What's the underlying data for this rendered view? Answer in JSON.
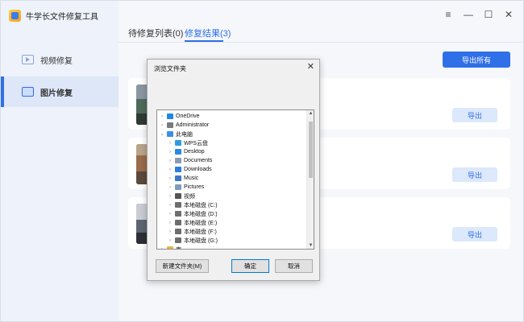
{
  "app": {
    "name": "牛学长文件修复工具",
    "accent": "#2f6fe8"
  },
  "sidebar": {
    "items": [
      {
        "label": "视频修复",
        "icon": "video-icon",
        "active": false
      },
      {
        "label": "图片修复",
        "icon": "image-icon",
        "active": true
      }
    ]
  },
  "tabs": [
    {
      "label": "待修复列表(0)",
      "active": false
    },
    {
      "label": "修复结果(3)",
      "active": true
    }
  ],
  "window_controls": {
    "menu": "≡",
    "minimize": "—",
    "maximize": "☐",
    "close": "✕"
  },
  "toolbar": {
    "export_all_label": "导出所有"
  },
  "results": [
    {
      "export_label": "导出"
    },
    {
      "export_label": "导出"
    },
    {
      "export_label": "导出"
    }
  ],
  "dialog": {
    "title": "浏览文件夹",
    "close": "✕",
    "tree": [
      {
        "label": "OneDrive",
        "icon": "cloud-icon",
        "color": "#1e88e5",
        "chev": "›"
      },
      {
        "label": "Administrator",
        "icon": "user-icon",
        "color": "#7a7a7a",
        "chev": "›"
      },
      {
        "label": "此电脑",
        "icon": "computer-icon",
        "color": "#3a8ee6",
        "chev": "⌄"
      },
      {
        "label": "WPS云盘",
        "icon": "cloud-icon",
        "color": "#2f9ae0",
        "chev": "›"
      },
      {
        "label": "Desktop",
        "icon": "desktop-icon",
        "color": "#2a8ae0",
        "chev": "›"
      },
      {
        "label": "Documents",
        "icon": "document-icon",
        "color": "#8d9bb0",
        "chev": "›"
      },
      {
        "label": "Downloads",
        "icon": "download-icon",
        "color": "#2a7fd8",
        "chev": "›"
      },
      {
        "label": "Music",
        "icon": "music-icon",
        "color": "#3b78c9",
        "chev": "›"
      },
      {
        "label": "Pictures",
        "icon": "picture-icon",
        "color": "#7f9bbd",
        "chev": "›"
      },
      {
        "label": "视频",
        "icon": "film-icon",
        "color": "#555555",
        "chev": "›"
      },
      {
        "label": "本地磁盘 (C:)",
        "icon": "drive-icon",
        "color": "#6d6d6d",
        "chev": "›"
      },
      {
        "label": "本地磁盘 (D:)",
        "icon": "drive-icon",
        "color": "#6d6d6d",
        "chev": "›"
      },
      {
        "label": "本地磁盘 (E:)",
        "icon": "drive-icon",
        "color": "#6d6d6d",
        "chev": "›"
      },
      {
        "label": "本地磁盘 (F:)",
        "icon": "drive-icon",
        "color": "#6d6d6d",
        "chev": "›"
      },
      {
        "label": "本地磁盘 (G:)",
        "icon": "drive-icon",
        "color": "#6d6d6d",
        "chev": "›"
      },
      {
        "label": "库",
        "icon": "folder-icon",
        "color": "#e8b64a",
        "chev": "›"
      }
    ],
    "buttons": {
      "new_folder": "新建文件夹(M)",
      "ok": "确定",
      "cancel": "取消"
    }
  }
}
